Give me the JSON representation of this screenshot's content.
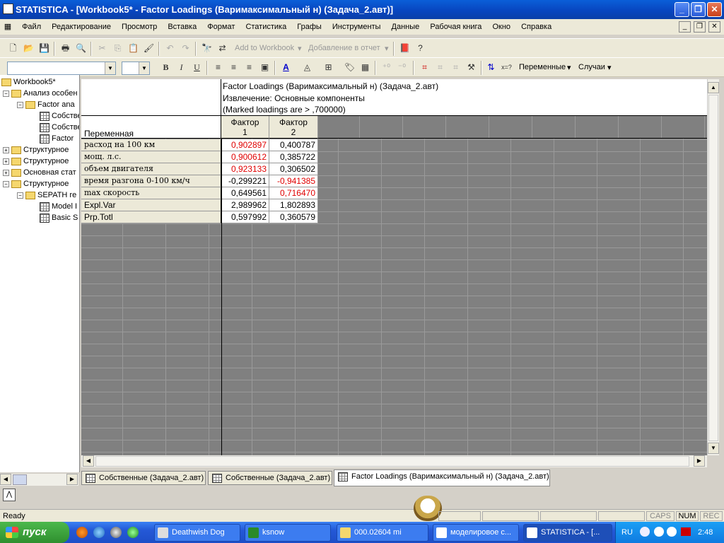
{
  "window": {
    "title": "STATISTICA - [Workbook5* - Factor Loadings (Варимаксимальный н) (Задача_2.авт)]"
  },
  "menu": [
    "Файл",
    "Редактирование",
    "Просмотр",
    "Вставка",
    "Формат",
    "Статистика",
    "Графы",
    "Инструменты",
    "Данные",
    "Рабочая книга",
    "Окно",
    "Справка"
  ],
  "toolbar": {
    "add_to_workbook": "Add to Workbook",
    "add_to_report": "Добавление в отчет",
    "variables": "Переменные",
    "cases": "Случаи",
    "bold": "B",
    "italic": "I",
    "underline": "U"
  },
  "tree": [
    {
      "label": "Workbook5*",
      "level": 0
    },
    {
      "label": "Анализ особен",
      "level": 1
    },
    {
      "label": "Factor ana",
      "level": 2
    },
    {
      "label": "Собстве",
      "level": 3
    },
    {
      "label": "Собстве",
      "level": 3
    },
    {
      "label": "Factor",
      "level": 3
    },
    {
      "label": "Структурное",
      "level": 1
    },
    {
      "label": "Структурное",
      "level": 1
    },
    {
      "label": "Основная стат",
      "level": 1
    },
    {
      "label": "Структурное",
      "level": 1
    },
    {
      "label": "SEPATH re",
      "level": 2
    },
    {
      "label": "Model I",
      "level": 3
    },
    {
      "label": "Basic S",
      "level": 3
    }
  ],
  "sheet": {
    "header_lines": [
      "Factor Loadings (Варимаксимальный н) (Задача_2.авт)",
      "Извлечение: Основные компоненты",
      "(Marked loadings are > ,700000)"
    ],
    "var_header": "Переменная",
    "col1": [
      "Фактор",
      "1"
    ],
    "col2": [
      "Фактор",
      "2"
    ],
    "rows": [
      {
        "name": "расход на 100 км",
        "f1": "0,902897",
        "f2": "0,400787",
        "f1_red": true,
        "f2_red": false
      },
      {
        "name": "мощ. л.с.",
        "f1": "0,900612",
        "f2": "0,385722",
        "f1_red": true,
        "f2_red": false
      },
      {
        "name": "объем двигателя",
        "f1": "0,923133",
        "f2": "0,306502",
        "f1_red": true,
        "f2_red": false
      },
      {
        "name": "время разгона 0-100 км/ч",
        "f1": "-0,299221",
        "f2": "-0,941385",
        "f1_red": false,
        "f2_red": true
      },
      {
        "name": "max скорость",
        "f1": "0,649561",
        "f2": "0,716470",
        "f1_red": false,
        "f2_red": true
      },
      {
        "name": "Expl.Var",
        "f1": "2,989962",
        "f2": "1,802893",
        "f1_red": false,
        "f2_red": false
      },
      {
        "name": "Prp.Totl",
        "f1": "0,597992",
        "f2": "0,360579",
        "f1_red": false,
        "f2_red": false
      }
    ]
  },
  "tabs": [
    {
      "label": "Собственные (Задача_2.авт)"
    },
    {
      "label": "Собственные (Задача_2.авт)"
    },
    {
      "label": "Factor Loadings (Варимаксимальный н) (Задача_2.авт)"
    }
  ],
  "status": {
    "text": "Ready",
    "caps": "CAPS",
    "num": "NUM",
    "rec": "REC"
  },
  "taskbar": {
    "start": "пуск",
    "tasks": [
      "Deathwish Dog",
      "ksnow",
      "000.02604 mi",
      "моделировое с...",
      "STATISTICA - [..."
    ],
    "lang": "RU",
    "clock": "2:48"
  }
}
